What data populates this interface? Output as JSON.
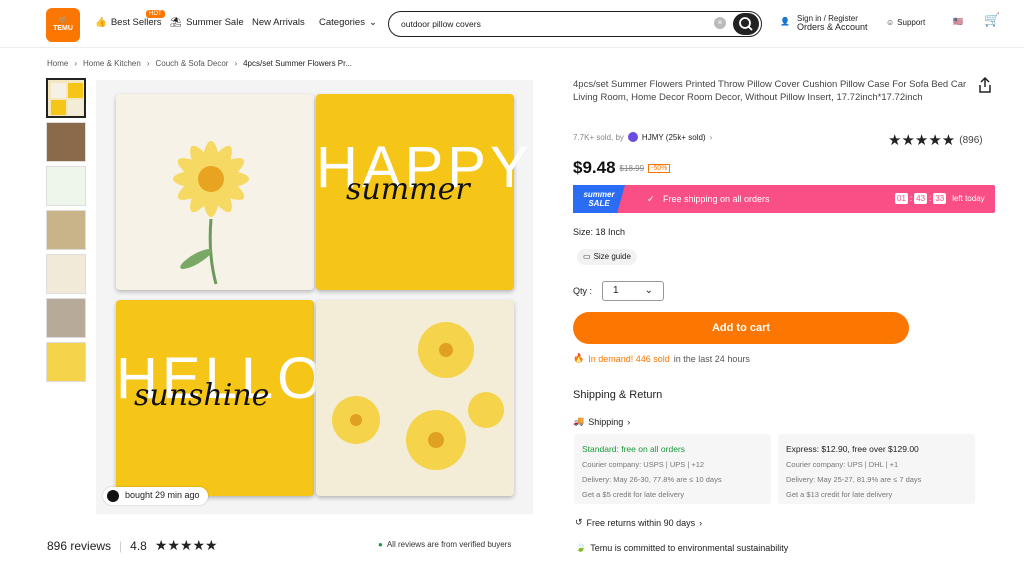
{
  "header": {
    "logo_text": "TEMU",
    "nav": [
      "Best Sellers",
      "Summer Sale",
      "New Arrivals",
      "Categories"
    ],
    "hot_badge": "HOT",
    "search_value": "outdoor pillow covers",
    "sign_in": "Sign in / Register",
    "orders": "Orders & Account",
    "support": "Support"
  },
  "breadcrumb": [
    "Home",
    "Home & Kitchen",
    "Couch & Sofa Decor",
    "4pcs/set Summer Flowers Pr..."
  ],
  "gallery": {
    "bought": "bought 29 min ago",
    "pillow_words": [
      "summer",
      "HAPPY",
      "sunshine",
      "HELLO"
    ]
  },
  "reviews": {
    "count": "896 reviews",
    "rating": "4.8",
    "verified": "All reviews are from verified buyers"
  },
  "product": {
    "title": "4pcs/set Summer Flowers Printed Throw Pillow Cover Cushion Pillow Case For Sofa Bed Car Living Room, Home Decor Room Decor, Without Pillow Insert, 17.72inch*17.72inch",
    "sold": "7.7K+ sold, by",
    "seller": "HJMY (25k+ sold)",
    "rating_count": "(896)",
    "price": "$9.48",
    "old_price": "$18.99",
    "discount": "-50%",
    "sale_badge": "summer SALE",
    "free_shipping": "Free shipping on all orders",
    "timer": [
      "01",
      "43",
      "33"
    ],
    "timer_suffix": "left today",
    "size_label": "Size: 18 Inch",
    "size_guide": "Size guide",
    "qty_label": "Qty :",
    "qty_value": "1",
    "add_to_cart": "Add to cart",
    "demand_highlight": "In demand! 446 sold",
    "demand_rest": "in the last 24 hours"
  },
  "shipping": {
    "heading": "Shipping & Return",
    "link": "Shipping",
    "standard": {
      "title": "Standard: free on all orders",
      "courier": "Courier company:  USPS  |  UPS  | +12",
      "delivery": "Delivery: May 26-30, 77.8% are ≤ 10 days",
      "credit": "Get a $5 credit for late delivery"
    },
    "express": {
      "title": "Express: $12.90, free over $129.00",
      "courier": "Courier company:  UPS  |  DHL  | +1",
      "delivery": "Delivery: May 25-27, 81.9% are ≤ 7 days",
      "credit": "Get a $13 credit for late delivery"
    },
    "returns": "Free returns within 90 days",
    "env": "Temu is committed to environmental sustainability"
  },
  "colors": {
    "accent": "#fb7701",
    "banner": "#f94f86",
    "yellow": "#f5c518"
  }
}
